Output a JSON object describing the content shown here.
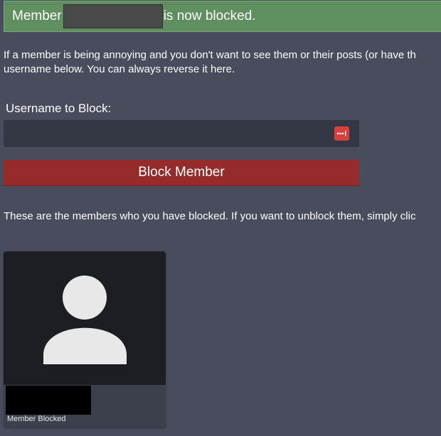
{
  "alert": {
    "prefix": "Member",
    "suffix": "is now blocked.",
    "color": "#5f8f5f"
  },
  "intro": {
    "line1": "If a member is being annoying and you don't want to see them or their posts (or have th",
    "line2": "username below. You can always reverse it here."
  },
  "form": {
    "label": "Username to Block:",
    "input_value": "",
    "input_icon": "password-manager-icon",
    "button_label": "Block Member",
    "button_color": "#952b2b"
  },
  "blocked_section": {
    "text": "These are the members who you have blocked. If you want to unblock them, simply clic"
  },
  "blocked_members": [
    {
      "avatar_icon": "default-user-avatar-icon",
      "status": "Member Blocked"
    }
  ]
}
